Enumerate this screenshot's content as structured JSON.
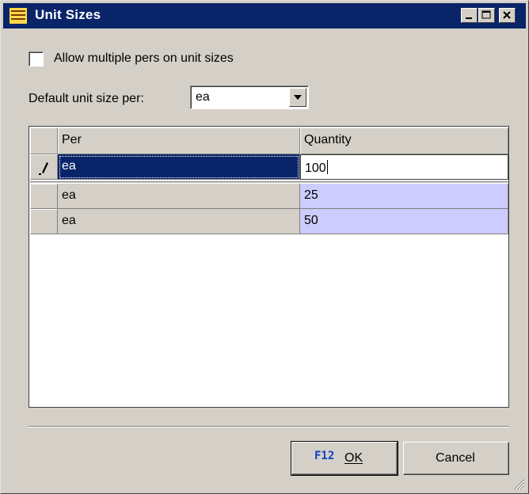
{
  "window": {
    "title": "Unit Sizes"
  },
  "options": {
    "allow_multiple_label": "Allow multiple pers on unit sizes",
    "allow_multiple_checked": false,
    "default_label": "Default unit size per:",
    "default_value": "ea"
  },
  "grid": {
    "headers": {
      "per": "Per",
      "quantity": "Quantity"
    },
    "edit_row": {
      "per": "ea",
      "quantity": "100"
    },
    "rows": [
      {
        "per": "ea",
        "quantity": "25"
      },
      {
        "per": "ea",
        "quantity": "50"
      }
    ]
  },
  "buttons": {
    "ok_shortcut": "F12",
    "ok_label": "OK",
    "cancel_label": "Cancel"
  },
  "colors": {
    "titlebar": "#0a246a",
    "row_highlight": "#ccccff",
    "face": "#d4d0c8"
  }
}
